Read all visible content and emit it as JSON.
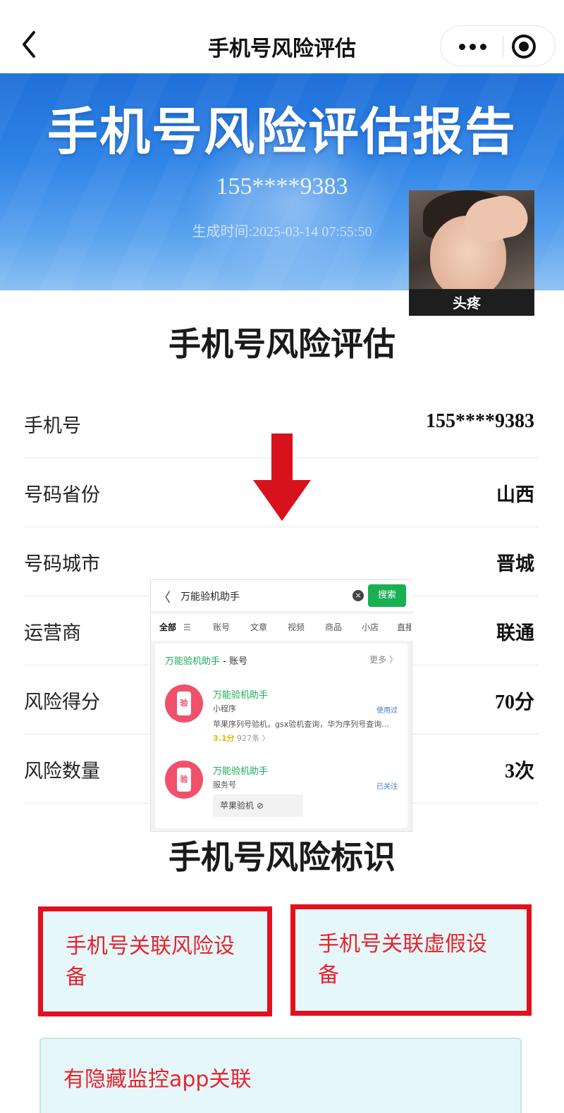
{
  "nav": {
    "title": "手机号风险评估"
  },
  "banner": {
    "title": "手机号风险评估报告",
    "phone": "155****9383",
    "generated": "生成时间:2025-03-14 07:55:50"
  },
  "meme": {
    "caption": "头疼"
  },
  "assessment": {
    "heading": "手机号风险评估",
    "rows": [
      {
        "label": "手机号",
        "value": "155****9383"
      },
      {
        "label": "号码省份",
        "value": "山西"
      },
      {
        "label": "号码城市",
        "value": "晋城"
      },
      {
        "label": "运营商",
        "value": "联通"
      },
      {
        "label": "风险得分",
        "value": "70分"
      },
      {
        "label": "风险数量",
        "value": "3次"
      }
    ]
  },
  "overlay": {
    "query": "万能验机助手",
    "search_button": "搜索",
    "tabs": [
      "全部",
      "账号",
      "文章",
      "视频",
      "商品",
      "小店",
      "直播"
    ],
    "card_head_name": "万能验机助手",
    "card_head_suffix": " - 账号",
    "more": "更多 〉",
    "item1": {
      "name": "万能验机助手",
      "type": "小程序",
      "tag": "使用过",
      "desc": "苹果序列号验机，gsx验机查询，华为序列号查询...",
      "score": "3.1分",
      "count": " 927条 〉",
      "icon_text": "验"
    },
    "item2": {
      "name": "万能验机助手",
      "type": "服务号",
      "tag": "已关注",
      "chip": "苹果验机 ⊘",
      "icon_text": "验"
    }
  },
  "risk_tags": {
    "heading": "手机号风险标识",
    "tag1": "手机号关联风险设备",
    "tag2": "手机号关联虚假设备",
    "tag3": "有隐藏监控app关联"
  },
  "colors": {
    "accent_red": "#e3101e",
    "tag_bg": "#e6f7fa",
    "banner_blue": "#2f84e6",
    "wechat_green": "#18b052"
  }
}
